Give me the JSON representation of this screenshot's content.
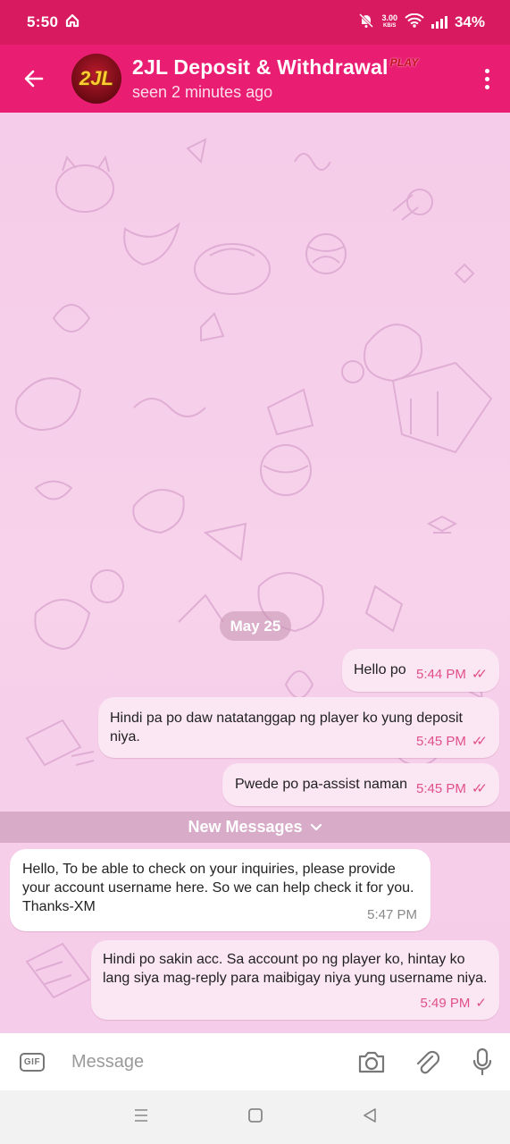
{
  "status_bar": {
    "time": "5:50",
    "net_speed_value": "3.00",
    "net_speed_unit": "KB/S",
    "battery": "34%",
    "icons": [
      "home-icon",
      "mute-icon",
      "wifi-icon",
      "signal-icon"
    ]
  },
  "header": {
    "title": "2JL Deposit & Withdrawal",
    "title_badge": "PLAY",
    "subtitle": "seen 2 minutes ago",
    "avatar_text": "2JL"
  },
  "chat": {
    "date": "May 25",
    "new_messages_label": "New Messages",
    "messages": [
      {
        "direction": "out",
        "text": "Hello po",
        "time": "5:44 PM",
        "status": "read"
      },
      {
        "direction": "out",
        "text": "Hindi pa po daw natatanggap ng player ko yung deposit niya.",
        "time": "5:45 PM",
        "status": "read"
      },
      {
        "direction": "out",
        "text": "Pwede po pa-assist naman",
        "time": "5:45 PM",
        "status": "read"
      },
      {
        "direction": "in",
        "text": "Hello, To be able to check on your inquiries, please provide your account username here. So we can help check it for you. Thanks-XM",
        "time": "5:47 PM"
      },
      {
        "direction": "out",
        "text": "Hindi po sakin acc. Sa account po ng player ko, hintay ko lang siya mag-reply para maibigay niya yung username niya.",
        "time": "5:49 PM",
        "status": "sent"
      }
    ]
  },
  "composer": {
    "placeholder": "Message"
  },
  "colors": {
    "status_bar": "#d81b60",
    "header": "#e91e73",
    "chat_bg": "#f5cce9",
    "outgoing_bubble": "#fbe6f3",
    "time_accent": "#e0508a"
  }
}
